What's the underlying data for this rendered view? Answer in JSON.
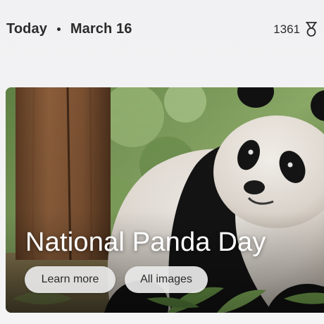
{
  "header": {
    "day_label": "Today",
    "date_label": "March 16",
    "points_value": "1361",
    "points_icon": "medal-icon"
  },
  "card": {
    "title": "National Panda Day",
    "learn_more_label": "Learn more",
    "all_images_label": "All images",
    "photo_subject": "panda-photo"
  }
}
